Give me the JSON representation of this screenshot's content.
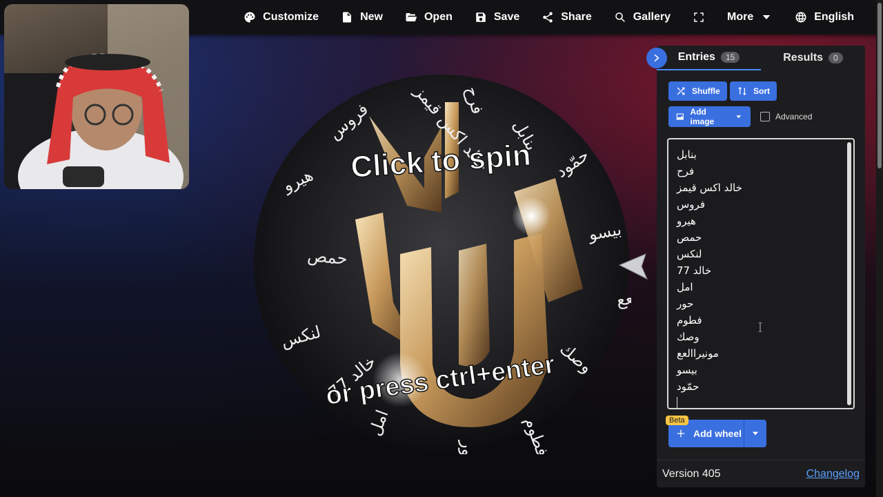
{
  "toolbar": {
    "items": [
      {
        "label": "Customize",
        "icon": "palette-icon"
      },
      {
        "label": "New",
        "icon": "file-icon"
      },
      {
        "label": "Open",
        "icon": "folder-open-icon"
      },
      {
        "label": "Save",
        "icon": "save-icon"
      },
      {
        "label": "Share",
        "icon": "share-icon"
      },
      {
        "label": "Gallery",
        "icon": "search-icon"
      },
      {
        "label": "",
        "icon": "fullscreen-icon"
      },
      {
        "label": "More",
        "icon": "caret-down-icon"
      },
      {
        "label": "English",
        "icon": "globe-icon"
      }
    ]
  },
  "wheel": {
    "top_text": "Click to spin",
    "bottom_text": "or press ctrl+enter",
    "rim_labels": [
      "بنابل",
      "حمّود",
      "بيسو",
      "مونيراالعع",
      "وصك",
      "فطوم",
      "حور",
      "امل",
      "خالد 77",
      "لنكس",
      "حمص",
      "هيرو",
      "فروس",
      "خالد اكس قيمز",
      "فرح"
    ]
  },
  "panel": {
    "tabs": [
      {
        "label": "Entries",
        "count": "15"
      },
      {
        "label": "Results",
        "count": "0"
      }
    ],
    "shuffle_label": "Shuffle",
    "sort_label": "Sort",
    "add_image_label": "Add image",
    "advanced_label": "Advanced",
    "entries": [
      "بنابل",
      "فرح",
      "خالد اكس قيمز",
      "فروس",
      "هيرو",
      "حمص",
      "لنكس",
      "خالد 77",
      "امل",
      "حور",
      "فطوم",
      "وصك",
      "مونيراالعع",
      "بيسو",
      "حمّود"
    ],
    "beta_label": "Beta",
    "add_wheel_label": "Add wheel",
    "version_label": "Version 405",
    "changelog_label": "Changelog"
  },
  "colors": {
    "accent": "#3a6fe0",
    "panel_bg": "#1d1d1f",
    "beta_bg": "#f6c343",
    "link": "#5aa0ff"
  }
}
